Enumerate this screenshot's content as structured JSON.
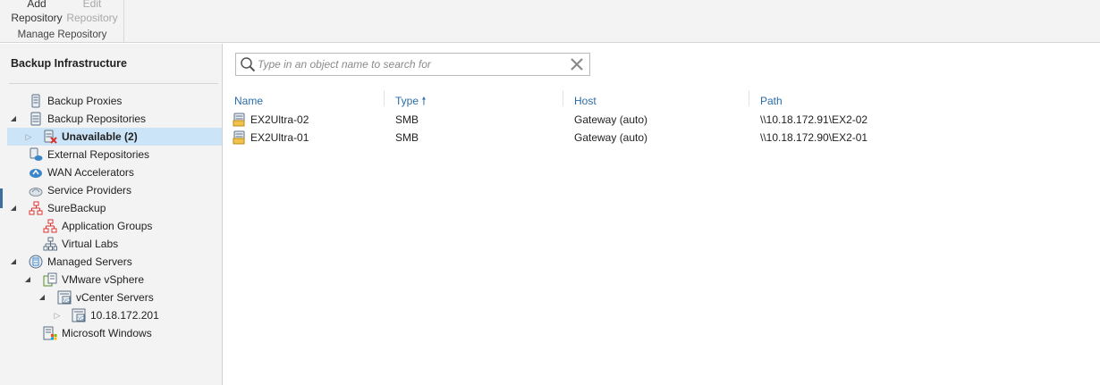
{
  "ribbon": {
    "add_repository_label_1": "Add",
    "add_repository_label_2": "Repository",
    "edit_repository_label_1": "Edit",
    "edit_repository_label_2": "Repository",
    "group_label": "Manage Repository"
  },
  "sidebar": {
    "title": "Backup Infrastructure",
    "items": [
      {
        "label": "Backup Proxies",
        "icon": "backup-proxies-icon"
      },
      {
        "label": "Backup Repositories",
        "icon": "backup-repositories-icon",
        "expanded": true
      },
      {
        "label": "Unavailable (2)",
        "icon": "unavailable-repository-icon",
        "selected": true
      },
      {
        "label": "External Repositories",
        "icon": "external-repositories-icon"
      },
      {
        "label": "WAN Accelerators",
        "icon": "wan-accelerators-icon"
      },
      {
        "label": "Service Providers",
        "icon": "service-providers-icon"
      },
      {
        "label": "SureBackup",
        "icon": "surebackup-icon",
        "expanded": true
      },
      {
        "label": "Application Groups",
        "icon": "application-groups-icon"
      },
      {
        "label": "Virtual Labs",
        "icon": "virtual-labs-icon"
      },
      {
        "label": "Managed Servers",
        "icon": "managed-servers-icon",
        "expanded": true
      },
      {
        "label": "VMware vSphere",
        "icon": "vmware-vsphere-icon",
        "expanded": true
      },
      {
        "label": "vCenter Servers",
        "icon": "vcenter-servers-icon",
        "expanded": true
      },
      {
        "label": "10.18.172.201",
        "icon": "vcenter-server-icon"
      },
      {
        "label": "Microsoft Windows",
        "icon": "microsoft-windows-icon"
      }
    ]
  },
  "search": {
    "placeholder": "Type in an object name to search for",
    "value": ""
  },
  "table": {
    "columns": [
      "Name",
      "Type",
      "Host",
      "Path"
    ],
    "sort_column": "Type",
    "sort_direction": "ascending",
    "rows": [
      {
        "name": "EX2Ultra-02",
        "type": "SMB",
        "host": "Gateway (auto)",
        "path": "\\\\10.18.172.91\\EX2-02"
      },
      {
        "name": "EX2Ultra-01",
        "type": "SMB",
        "host": "Gateway (auto)",
        "path": "\\\\10.18.172.90\\EX2-01"
      }
    ]
  },
  "colors": {
    "accent": "#2b6ca7",
    "selection": "#cce4f7",
    "panel": "#f3f3f3",
    "error": "#d9302c"
  }
}
